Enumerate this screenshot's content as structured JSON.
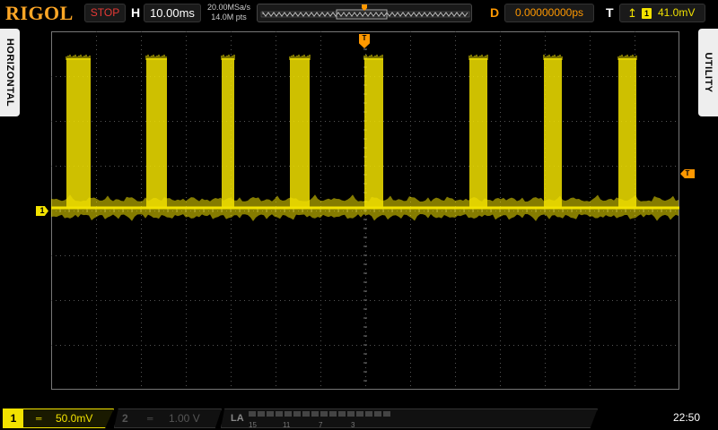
{
  "brand": "RIGOL",
  "run_state": "STOP",
  "horizontal": {
    "letter": "H",
    "timebase": "10.00ms",
    "sample_rate": "20.00MSa/s",
    "memory_depth": "14.0M pts"
  },
  "delay": {
    "letter": "D",
    "value": "0.00000000ps"
  },
  "trigger": {
    "letter": "T",
    "edge_icon": "rising-edge-icon",
    "source": "1",
    "level": "41.0mV",
    "marker": "T"
  },
  "side_menus": {
    "left": "HORIZONTAL",
    "right": "UTILITY"
  },
  "channels": {
    "ch1": {
      "number": "1",
      "coupling": "═",
      "scale": "50.0mV",
      "marker": "1",
      "color": "#f2e200"
    },
    "ch2": {
      "number": "2",
      "coupling": "═",
      "scale": "1.00 V"
    }
  },
  "logic_analyzer": {
    "label": "LA",
    "bit_labels": [
      "15",
      "11",
      "7",
      "3"
    ]
  },
  "clock": "22:50",
  "colors": {
    "ch1": "#f2e200",
    "trigger": "#ff9800",
    "stop": "#e53935",
    "brand": "#ffa726"
  }
}
